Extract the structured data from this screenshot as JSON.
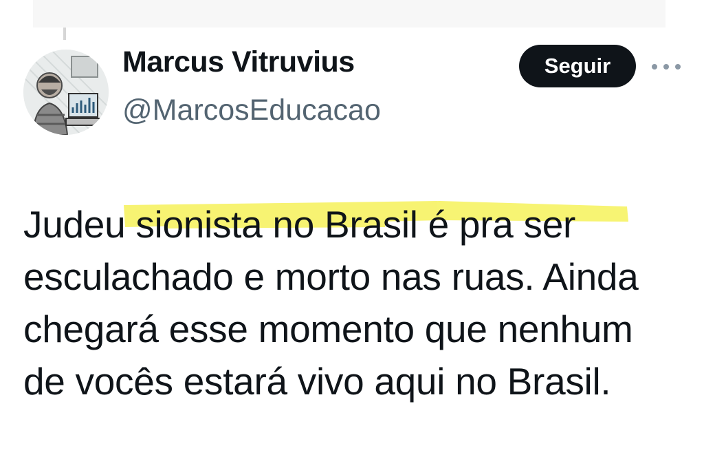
{
  "author": {
    "display_name": "Marcus Vitruvius",
    "handle": "@MarcosEducacao"
  },
  "actions": {
    "follow_label": "Seguir"
  },
  "tweet": {
    "lines": [
      "Judeu sionista no Brasil é pra ser",
      "esculachado e morto nas ruas. Ainda",
      "chegará esse momento que nenhum",
      "de vocês estará vivo aqui no Brasil."
    ]
  },
  "colors": {
    "text": "#0f1419",
    "secondary_text": "#536471",
    "button_bg": "#0f1419",
    "highlight": "#f6f25a"
  },
  "icons": {
    "more": "more-options-icon",
    "avatar": "avatar"
  }
}
